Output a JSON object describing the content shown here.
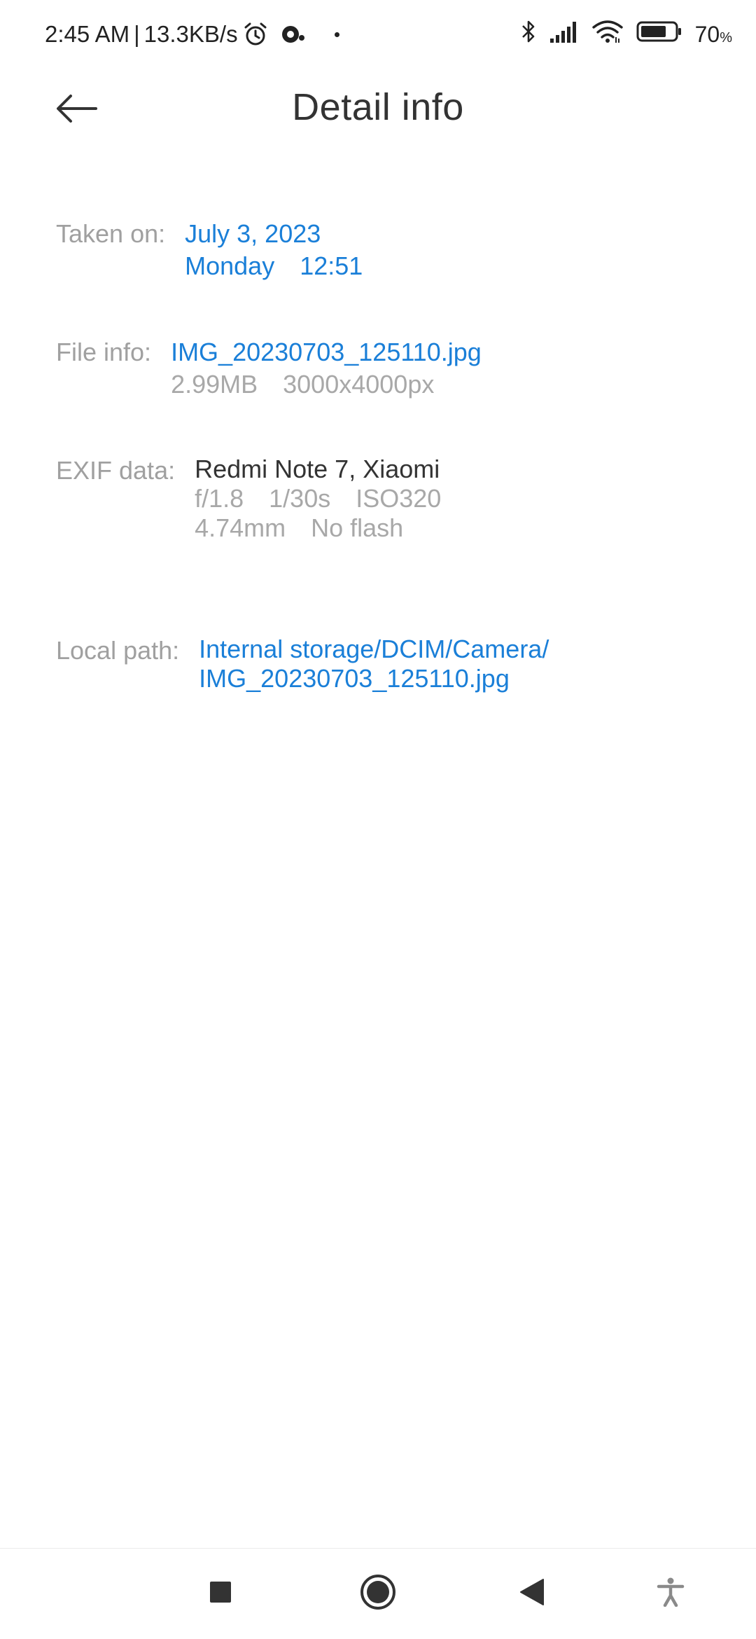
{
  "status_bar": {
    "time": "2:45 AM",
    "separator": "|",
    "net_speed": "13.3KB/s",
    "battery_percent": "70",
    "battery_unit": "%"
  },
  "header": {
    "title": "Detail info"
  },
  "details": {
    "taken_on": {
      "label": "Taken on:",
      "date": "July 3, 2023",
      "weekday": "Monday",
      "time": "12:51"
    },
    "file_info": {
      "label": "File info:",
      "filename": "IMG_20230703_125110.jpg",
      "size": "2.99MB",
      "resolution": "3000x4000px"
    },
    "exif": {
      "label": "EXIF data:",
      "device": "Redmi Note 7, Xiaomi",
      "aperture": "f/1.8",
      "shutter": "1/30s",
      "iso": "ISO320",
      "focal_length": "4.74mm",
      "flash": "No flash"
    },
    "local_path": {
      "label": "Local path:",
      "line1": "Internal storage/DCIM/Camera/",
      "line2": "IMG_20230703_125110.jpg"
    }
  },
  "icons": {
    "back": "arrow-left-icon",
    "alarm": "alarm-icon",
    "notification": "notification-icon",
    "bluetooth": "bluetooth-icon",
    "signal": "signal-icon",
    "wifi": "wifi-icon",
    "battery": "battery-icon",
    "nav_recents": "square-icon",
    "nav_home": "circle-icon",
    "nav_back": "triangle-back-icon",
    "accessibility": "accessibility-icon"
  },
  "colors": {
    "link": "#1a7fd8",
    "label": "#a0a0a0",
    "text": "#333333",
    "background": "#ffffff"
  }
}
